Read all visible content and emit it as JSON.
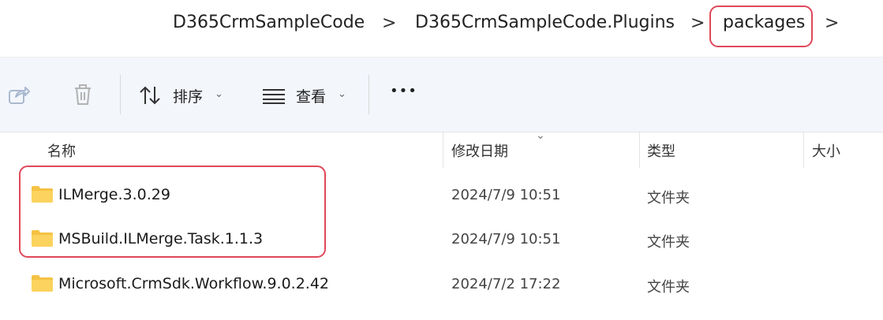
{
  "breadcrumb": {
    "items": [
      "D365CrmSampleCode",
      "D365CrmSampleCode.Plugins",
      "packages"
    ],
    "separator": ">"
  },
  "toolbar": {
    "share_icon": "share-icon",
    "delete_icon": "trash-icon",
    "sort_label": "排序",
    "view_label": "查看",
    "more_label": "•••"
  },
  "columns": {
    "name": "名称",
    "modified": "修改日期",
    "type": "类型",
    "size": "大小"
  },
  "files": [
    {
      "name": "ILMerge.3.0.29",
      "modified": "2024/7/9 10:51",
      "type": "文件夹"
    },
    {
      "name": "MSBuild.ILMerge.Task.1.1.3",
      "modified": "2024/7/9 10:51",
      "type": "文件夹"
    },
    {
      "name": "Microsoft.CrmSdk.Workflow.9.0.2.42",
      "modified": "2024/7/2 17:22",
      "type": "文件夹"
    }
  ],
  "colors": {
    "highlight": "#e0485a",
    "folder": "#f5c244",
    "toolbar_bg": "#f3f6fb"
  }
}
